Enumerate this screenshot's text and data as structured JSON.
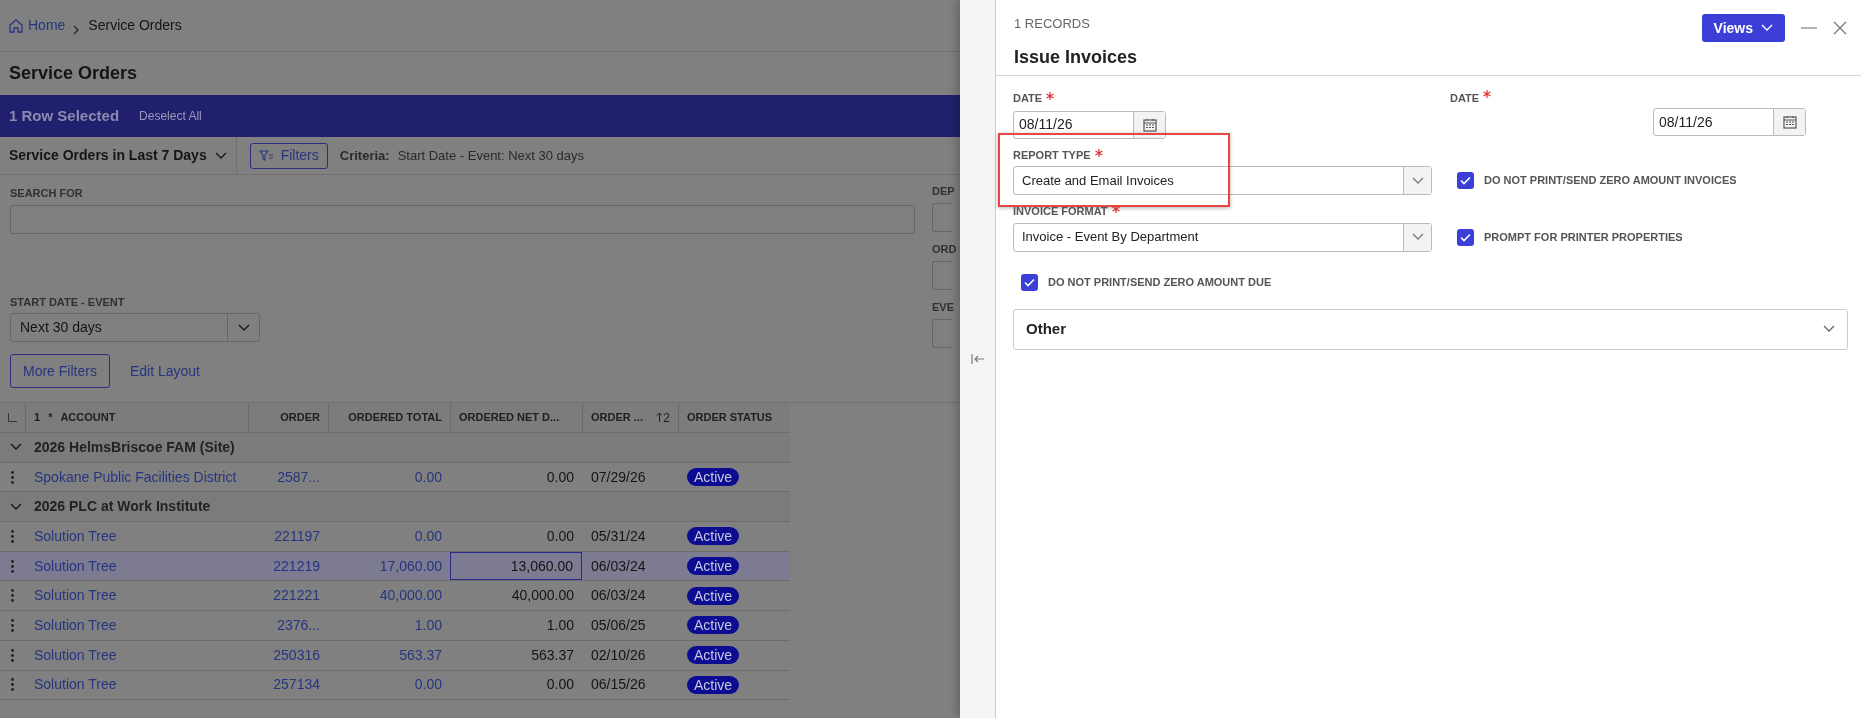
{
  "breadcrumb": [
    {
      "kind": "home",
      "label": "Home"
    },
    {
      "kind": "page",
      "label": "Service Orders"
    }
  ],
  "page_title": "Service Orders",
  "selection_bar": {
    "text": "1 Row Selected",
    "action": "Deselect All"
  },
  "toolbar": {
    "view": "Service Orders in Last 7 Days",
    "filters_button": "Filters",
    "criteria_label": "Criteria:",
    "criteria_value": "Start Date - Event: Next 30 days"
  },
  "filters": {
    "search_label": "SEARCH FOR",
    "cut_labels": [
      "DEP",
      "ORD",
      "EVE"
    ],
    "start_date_label": "START DATE - EVENT",
    "start_date_value": "Next 30 days",
    "more_filters": "More Filters",
    "edit_layout": "Edit Layout"
  },
  "table": {
    "group_count": "1",
    "required_mark": "*",
    "sort_index": "2",
    "columns": [
      {
        "label": "ACCOUNT",
        "sorted": false
      },
      {
        "label": "ORDER",
        "sorted": false
      },
      {
        "label": "ORDERED TOTAL",
        "sorted": false
      },
      {
        "label": "ORDERED NET D...",
        "sorted": false
      },
      {
        "label": "ORDER ...",
        "sorted": true
      },
      {
        "label": "ORDER STATUS",
        "sorted": false
      }
    ],
    "rows": [
      {
        "kind": "group",
        "label": "2026 HelmsBriscoe FAM (Site)",
        "expanded": true
      },
      {
        "kind": "data",
        "selected": false,
        "focused": false,
        "cells": [
          "Spokane Public Facilities District",
          "2587...",
          "0.00",
          "0.00",
          "07/29/26",
          "Active"
        ]
      },
      {
        "kind": "group",
        "label": "2026 PLC at Work Institute",
        "expanded": true
      },
      {
        "kind": "data",
        "selected": false,
        "focused": false,
        "cells": [
          "Solution Tree",
          "221197",
          "0.00",
          "0.00",
          "05/31/24",
          "Active"
        ]
      },
      {
        "kind": "data",
        "selected": true,
        "focused": true,
        "cells": [
          "Solution Tree",
          "221219",
          "17,060.00",
          "13,060.00",
          "06/03/24",
          "Active"
        ]
      },
      {
        "kind": "data",
        "selected": false,
        "focused": false,
        "cells": [
          "Solution Tree",
          "221221",
          "40,000.00",
          "40,000.00",
          "06/03/24",
          "Active"
        ]
      },
      {
        "kind": "data",
        "selected": false,
        "focused": false,
        "cells": [
          "Solution Tree",
          "2376...",
          "1.00",
          "1.00",
          "05/06/25",
          "Active"
        ]
      },
      {
        "kind": "data",
        "selected": false,
        "focused": false,
        "cells": [
          "Solution Tree",
          "250316",
          "563.37",
          "563.37",
          "02/10/26",
          "Active"
        ]
      },
      {
        "kind": "data",
        "selected": false,
        "focused": false,
        "cells": [
          "Solution Tree",
          "257134",
          "0.00",
          "0.00",
          "06/15/26",
          "Active"
        ]
      }
    ]
  },
  "panel": {
    "records": "1 RECORDS",
    "title": "Issue Invoices",
    "views_button": "Views",
    "date_from": {
      "label": "DATE",
      "required": true,
      "value": "08/11/26"
    },
    "date_to": {
      "label": "DATE",
      "required": true,
      "value": "08/11/26"
    },
    "report_type": {
      "label": "REPORT TYPE",
      "required": true,
      "value": "Create and Email Invoices",
      "highlighted": true
    },
    "invoice_format": {
      "label": "INVOICE FORMAT",
      "required": true,
      "value": "Invoice - Event By Department"
    },
    "checkboxes": [
      {
        "label": "DO NOT PRINT/SEND ZERO AMOUNT INVOICES",
        "checked": true
      },
      {
        "label": "PROMPT FOR PRINTER PROPERTIES",
        "checked": true
      },
      {
        "label": "DO NOT PRINT/SEND ZERO AMOUNT DUE",
        "checked": true
      }
    ],
    "section": {
      "label": "Other",
      "expanded": false
    }
  }
}
